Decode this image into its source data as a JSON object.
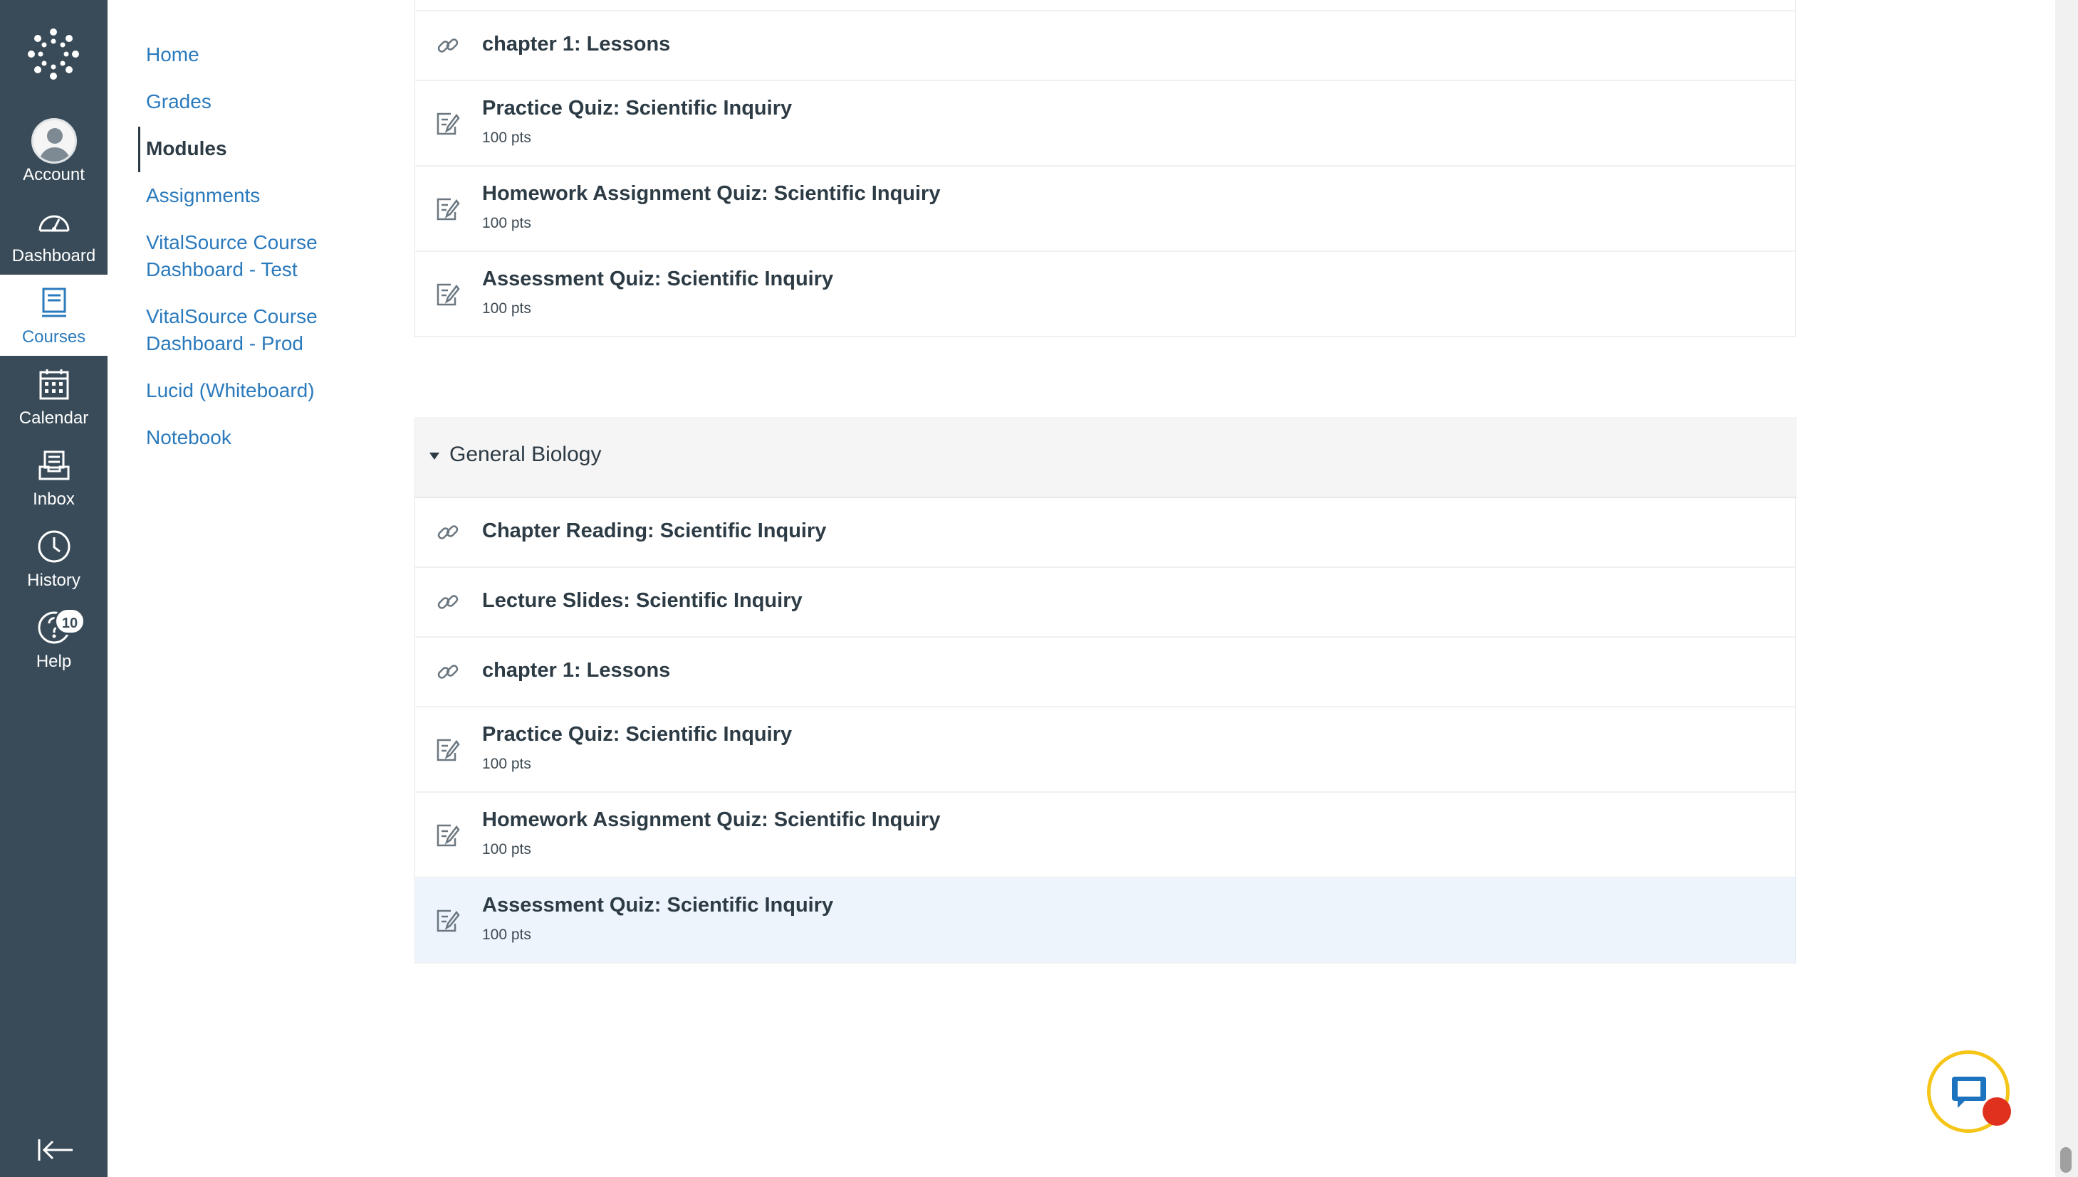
{
  "global_nav": {
    "account": "Account",
    "dashboard": "Dashboard",
    "courses": "Courses",
    "calendar": "Calendar",
    "inbox": "Inbox",
    "history": "History",
    "help": "Help",
    "help_badge": "10"
  },
  "course_nav": {
    "home": "Home",
    "grades": "Grades",
    "modules": "Modules",
    "assignments": "Assignments",
    "vs_test_1": "VitalSource Course",
    "vs_test_2": "Dashboard - Test",
    "vs_prod_1": "VitalSource Course",
    "vs_prod_2": "Dashboard - Prod",
    "lucid": "Lucid (Whiteboard)",
    "notebook": "Notebook"
  },
  "module_prev": {
    "items": [
      {
        "title": "chapter 1: Lessons",
        "type": "link-icon"
      },
      {
        "title": "Practice Quiz: Scientific Inquiry",
        "points": "100 pts",
        "type": "quiz-icon"
      },
      {
        "title": "Homework Assignment Quiz: Scientific Inquiry",
        "points": "100 pts",
        "type": "quiz-icon"
      },
      {
        "title": "Assessment Quiz: Scientific Inquiry",
        "points": "100 pts",
        "type": "quiz-icon"
      }
    ]
  },
  "module_bio": {
    "title": "General Biology",
    "items": [
      {
        "title": "Chapter Reading: Scientific Inquiry",
        "type": "link-icon"
      },
      {
        "title": "Lecture Slides: Scientific Inquiry",
        "type": "link-icon"
      },
      {
        "title": "chapter 1: Lessons",
        "type": "link-icon"
      },
      {
        "title": "Practice Quiz: Scientific Inquiry",
        "points": "100 pts",
        "type": "quiz-icon"
      },
      {
        "title": "Homework Assignment Quiz: Scientific Inquiry",
        "points": "100 pts",
        "type": "quiz-icon"
      },
      {
        "title": "Assessment Quiz: Scientific Inquiry",
        "points": "100 pts",
        "type": "quiz-icon"
      }
    ]
  },
  "colors": {
    "nav_bg": "#394b58",
    "link": "#2b7abc",
    "text": "#2d3b45",
    "highlight_row": "#eef4fb",
    "chat_ring": "#f5c518",
    "chat_dot": "#e0301e"
  }
}
